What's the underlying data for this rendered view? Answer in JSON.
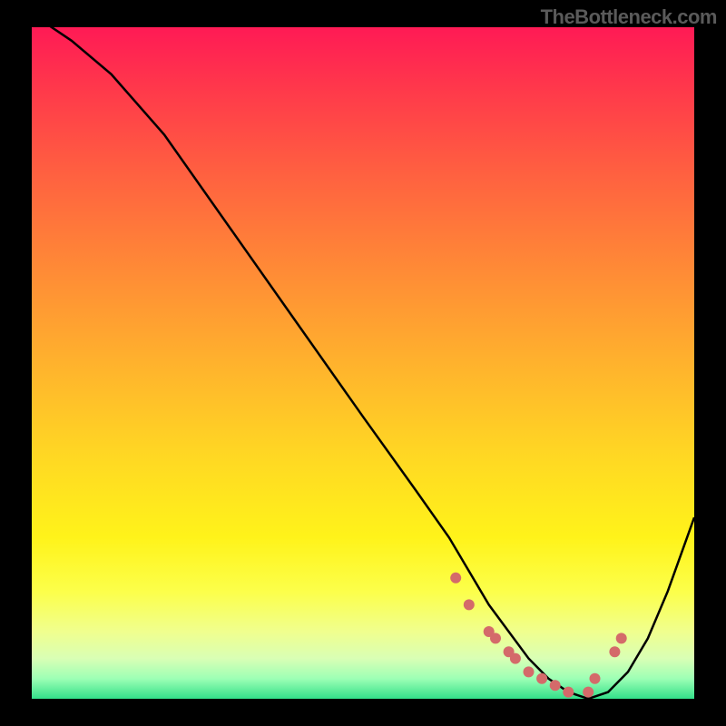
{
  "watermark": "TheBottleneck.com",
  "chart_data": {
    "type": "line",
    "title": "",
    "xlabel": "",
    "ylabel": "",
    "xlim": [
      0,
      100
    ],
    "ylim": [
      0,
      100
    ],
    "series": [
      {
        "name": "bottleneck-curve",
        "x": [
          0,
          6,
          12,
          20,
          30,
          40,
          50,
          58,
          63,
          66,
          69,
          72,
          75,
          78,
          81,
          84,
          87,
          90,
          93,
          96,
          100
        ],
        "y": [
          102,
          98,
          93,
          84,
          70,
          56,
          42,
          31,
          24,
          19,
          14,
          10,
          6,
          3,
          1,
          0,
          1,
          4,
          9,
          16,
          27
        ]
      }
    ],
    "highlight_points": {
      "name": "valley-dots",
      "color": "#d46a6a",
      "x": [
        64,
        66,
        69,
        70,
        72,
        73,
        75,
        77,
        79,
        81,
        84,
        85,
        88,
        89
      ],
      "y": [
        18,
        14,
        10,
        9,
        7,
        6,
        4,
        3,
        2,
        1,
        1,
        3,
        7,
        9
      ]
    },
    "gradient_stops": [
      {
        "pct": 0,
        "color": "#ff1a55"
      },
      {
        "pct": 22,
        "color": "#ff6140"
      },
      {
        "pct": 50,
        "color": "#ffb22d"
      },
      {
        "pct": 76,
        "color": "#fff31a"
      },
      {
        "pct": 94,
        "color": "#d9ffb5"
      },
      {
        "pct": 100,
        "color": "#33e08a"
      }
    ]
  }
}
